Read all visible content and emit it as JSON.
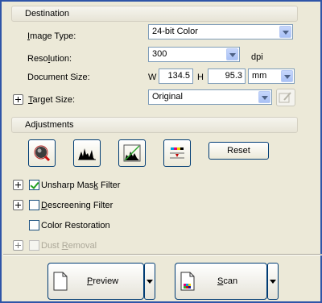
{
  "destination": {
    "header": "Destination",
    "image_type": {
      "label": "Image Type:",
      "underline": "I",
      "rest": "mage Type:",
      "value": "24-bit Color"
    },
    "resolution": {
      "label_pre": "Reso",
      "underline": "l",
      "label_post": "ution:",
      "value": "300",
      "unit": "dpi"
    },
    "document_size": {
      "label": "Document Size:",
      "w_label": "W",
      "w_value": "134.5",
      "h_label": "H",
      "h_value": "95.3",
      "unit": "mm"
    },
    "target_size": {
      "label_pre": "",
      "underline": "T",
      "label_post": "arget Size:",
      "value": "Original"
    }
  },
  "adjustments": {
    "header": "Adjustments",
    "reset_label": "Reset",
    "unsharp": {
      "label_pre": "Unsharp Mas",
      "underline": "k",
      "label_post": " Filter",
      "checked": true
    },
    "descreening": {
      "label_pre": "",
      "underline": "D",
      "label_post": "escreening Filter",
      "checked": false
    },
    "color_restoration": {
      "label": "Color Restoration",
      "checked": false
    },
    "dust_removal": {
      "label_pre": "Dust ",
      "underline": "R",
      "label_post": "emoval",
      "checked": false,
      "disabled": true
    }
  },
  "actions": {
    "preview": {
      "underline": "P",
      "rest": "review"
    },
    "scan": {
      "underline": "S",
      "rest": "can"
    }
  },
  "colors": {
    "frame_border": "#2f55a8",
    "panel": "#ece9d8",
    "field_border": "#7f9db9"
  },
  "icons": [
    "auto-exposure-icon",
    "histogram-icon",
    "tone-correction-icon",
    "image-adjustment-icon",
    "preview-document-icon",
    "scan-document-icon",
    "target-size-settings-icon"
  ]
}
